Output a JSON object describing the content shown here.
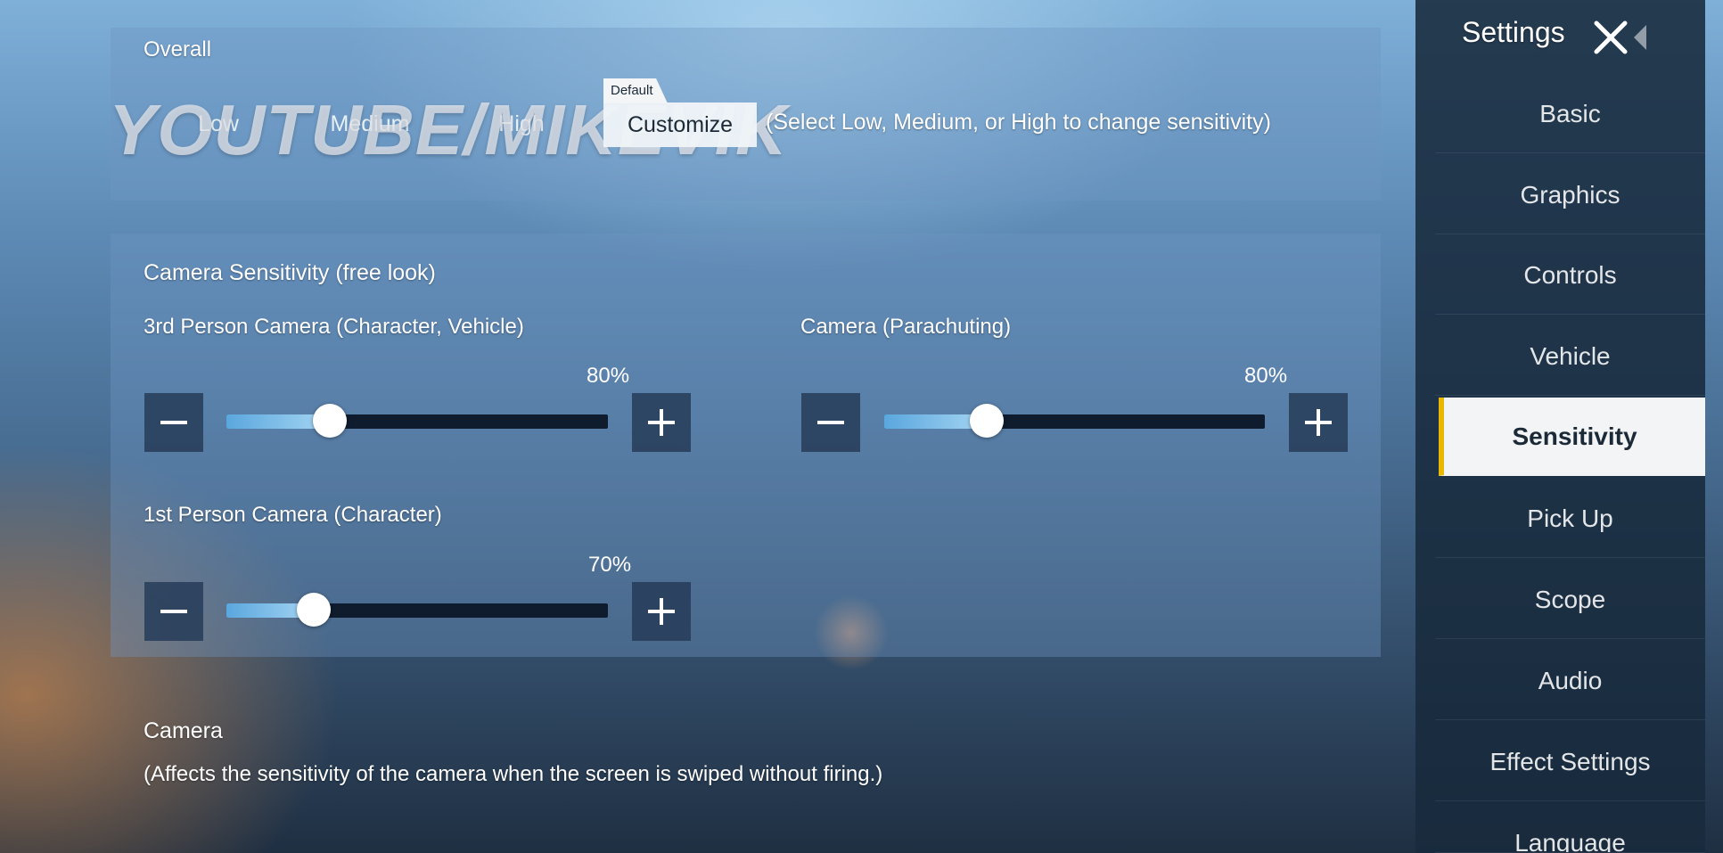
{
  "watermark": "YOUTUBE/MIKEVIK",
  "overall": {
    "title": "Overall",
    "options": [
      "Low",
      "Medium",
      "High"
    ],
    "selected_label": "Customize",
    "default_tag": "Default",
    "hint": "(Select Low, Medium, or High to change sensitivity)"
  },
  "camera_free_look": {
    "title": "Camera Sensitivity (free look)",
    "sliders": [
      {
        "label": "3rd Person Camera (Character, Vehicle)",
        "value": "80%",
        "fraction": 0.27
      },
      {
        "label": "Camera (Parachuting)",
        "value": "80%",
        "fraction": 0.27
      },
      {
        "label": "1st Person Camera (Character)",
        "value": "70%",
        "fraction": 0.23
      }
    ]
  },
  "camera_section": {
    "title": "Camera",
    "description": "(Affects the sensitivity of the camera when the screen is swiped without firing.)"
  },
  "sidebar": {
    "title": "Settings",
    "items": [
      {
        "label": "Basic"
      },
      {
        "label": "Graphics"
      },
      {
        "label": "Controls"
      },
      {
        "label": "Vehicle"
      },
      {
        "label": "Sensitivity",
        "active": true
      },
      {
        "label": "Pick Up"
      },
      {
        "label": "Scope"
      },
      {
        "label": "Audio"
      },
      {
        "label": "Effect Settings"
      },
      {
        "label": "Language"
      }
    ]
  },
  "colors": {
    "accent": "#e8b800",
    "active_bg": "#f2f4f6",
    "slider_fill": "#6fb4e6"
  }
}
